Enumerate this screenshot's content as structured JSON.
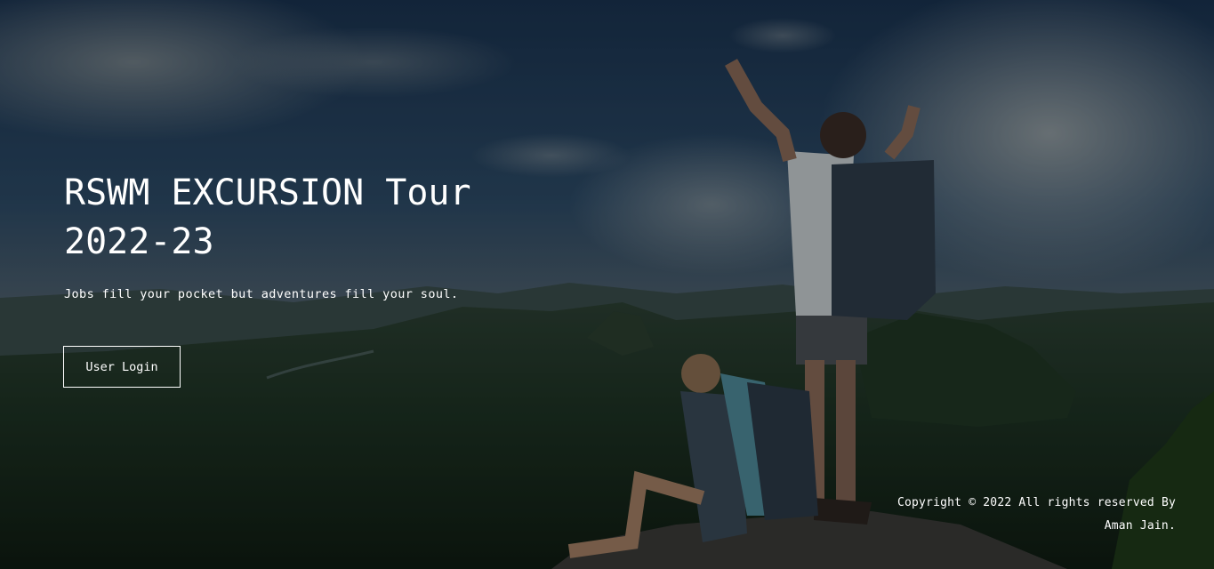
{
  "hero": {
    "title": "RSWM EXCURSION Tour 2022-23",
    "tagline": "Jobs fill your pocket but adventures fill your soul.",
    "login_label": "User Login"
  },
  "footer": {
    "copyright": "Copyright © 2022 All rights reserved By Aman Jain."
  },
  "colors": {
    "text": "#ffffff",
    "sky_top": "#1b3550",
    "valley": "#1c3322"
  }
}
